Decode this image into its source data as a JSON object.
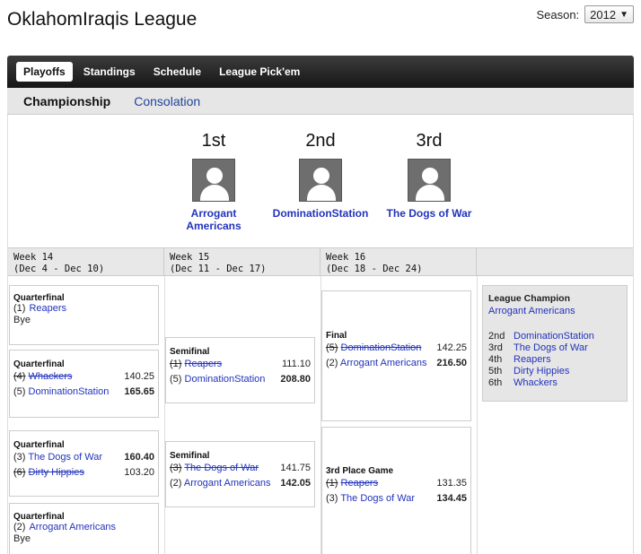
{
  "header": {
    "title": "OklahomIraqis League",
    "season_label": "Season:",
    "season_value": "2012",
    "dropdown_glyph": "▼"
  },
  "nav": {
    "tabs": [
      {
        "label": "Playoffs",
        "active": true
      },
      {
        "label": "Standings"
      },
      {
        "label": "Schedule"
      },
      {
        "label": "League Pick'em"
      }
    ]
  },
  "subtabs": {
    "items": [
      {
        "label": "Championship",
        "active": true
      },
      {
        "label": "Consolation"
      }
    ]
  },
  "podium": [
    {
      "place": "1st",
      "team_line1": "Arrogant",
      "team_line2": "Americans",
      "icon": "user-avatar-icon"
    },
    {
      "place": "2nd",
      "team_line1": "DominationStation",
      "team_line2": "",
      "icon": "user-avatar-icon"
    },
    {
      "place": "3rd",
      "team_line1": "The Dogs of War",
      "team_line2": "",
      "icon": "user-avatar-icon"
    }
  ],
  "weeks": [
    {
      "title": "Week 14",
      "range": "(Dec 4 - Dec 10)"
    },
    {
      "title": "Week 15",
      "range": "(Dec 11 - Dec 17)"
    },
    {
      "title": "Week 16",
      "range": "(Dec 18 - Dec 24)"
    }
  ],
  "matches": {
    "qf1": {
      "round": "Quarterfinal",
      "seed": "(1)",
      "team": "Reapers",
      "bye": "Bye"
    },
    "qf2": {
      "round": "Quarterfinal",
      "a": {
        "seed": "(4)",
        "team": "Whackers",
        "score": "140.25"
      },
      "b": {
        "seed": "(5)",
        "team": "DominationStation",
        "score": "165.65"
      }
    },
    "qf3": {
      "round": "Quarterfinal",
      "a": {
        "seed": "(3)",
        "team": "The Dogs of War",
        "score": "160.40"
      },
      "b": {
        "seed": "(6)",
        "team": "Dirty Hippies",
        "score": "103.20"
      }
    },
    "qf4": {
      "round": "Quarterfinal",
      "seed": "(2)",
      "team": "Arrogant Americans",
      "bye": "Bye"
    },
    "sf1": {
      "round": "Semifinal",
      "a": {
        "seed": "(1)",
        "team": "Reapers",
        "score": "111.10"
      },
      "b": {
        "seed": "(5)",
        "team": "DominationStation",
        "score": "208.80"
      }
    },
    "sf2": {
      "round": "Semifinal",
      "a": {
        "seed": "(3)",
        "team": "The Dogs of War",
        "score": "141.75"
      },
      "b": {
        "seed": "(2)",
        "team": "Arrogant Americans",
        "score": "142.05"
      }
    },
    "final": {
      "round": "Final",
      "a": {
        "seed": "(5)",
        "team": "DominationStation",
        "score": "142.25"
      },
      "b": {
        "seed": "(2)",
        "team": "Arrogant Americans",
        "score": "216.50"
      }
    },
    "third": {
      "round": "3rd Place Game",
      "a": {
        "seed": "(1)",
        "team": "Reapers",
        "score": "131.35"
      },
      "b": {
        "seed": "(3)",
        "team": "The Dogs of War",
        "score": "134.45"
      }
    }
  },
  "champion": {
    "label": "League Champion",
    "team": "Arrogant Americans",
    "ranks": [
      {
        "pos": "2nd",
        "team": "DominationStation"
      },
      {
        "pos": "3rd",
        "team": "The Dogs of War"
      },
      {
        "pos": "4th",
        "team": "Reapers"
      },
      {
        "pos": "5th",
        "team": "Dirty Hippies"
      },
      {
        "pos": "6th",
        "team": "Whackers"
      }
    ]
  }
}
